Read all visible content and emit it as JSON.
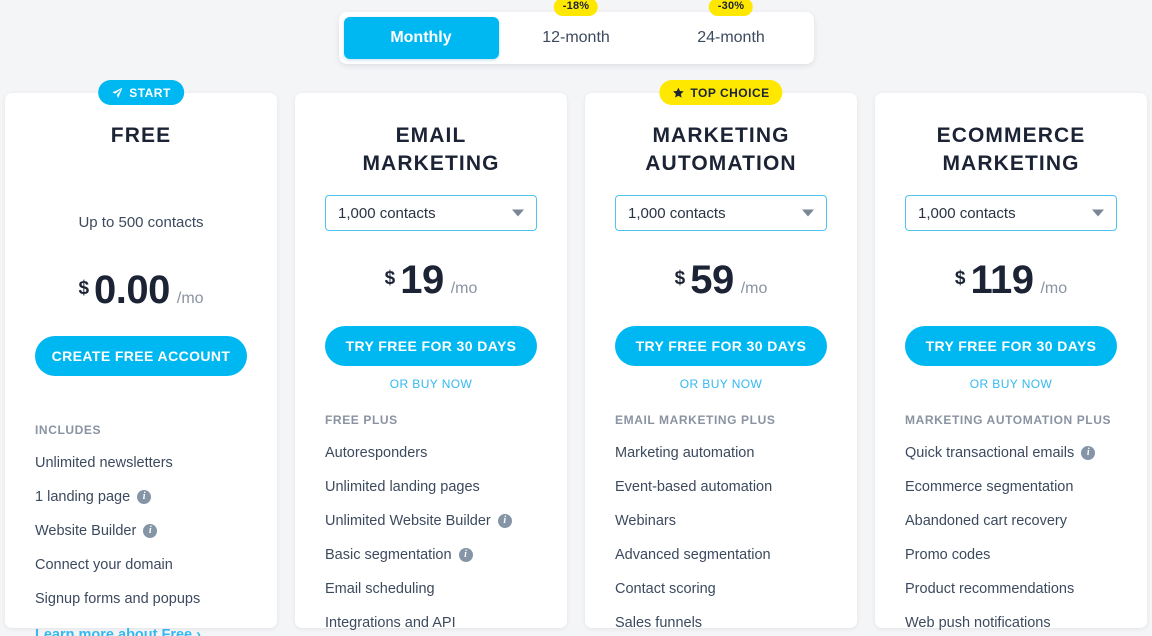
{
  "billing": {
    "options": [
      {
        "label": "Monthly",
        "discount": null,
        "active": true
      },
      {
        "label": "12-month",
        "discount": "-18%",
        "active": false
      },
      {
        "label": "24-month",
        "discount": "-30%",
        "active": false
      }
    ]
  },
  "colors": {
    "accent": "#00b8f1",
    "badge_yellow": "#ffe800",
    "text_dark": "#1b2335",
    "text_muted": "#8a93a2",
    "page_bg": "#f4f5f7"
  },
  "plans": [
    {
      "badge": {
        "text": "START",
        "icon": "rocket-icon",
        "style": "start"
      },
      "title": "FREE",
      "contacts_static": "Up to 500 contacts",
      "contacts_select": null,
      "currency": "$",
      "price": "0.00",
      "period": "/mo",
      "cta": "CREATE FREE ACCOUNT",
      "buy_now": null,
      "features_head": "INCLUDES",
      "features": [
        {
          "label": "Unlimited newsletters",
          "info": false
        },
        {
          "label": "1 landing page",
          "info": true
        },
        {
          "label": "Website Builder",
          "info": true
        },
        {
          "label": "Connect your domain",
          "info": false
        },
        {
          "label": "Signup forms and popups",
          "info": false
        }
      ],
      "learn_more": "Learn more about Free ›"
    },
    {
      "badge": null,
      "title": "EMAIL MARKETING",
      "contacts_static": null,
      "contacts_select": "1,000 contacts",
      "currency": "$",
      "price": "19",
      "period": "/mo",
      "cta": "TRY FREE FOR 30 DAYS",
      "buy_now": "OR BUY NOW",
      "features_head": "FREE PLUS",
      "features": [
        {
          "label": "Autoresponders",
          "info": false
        },
        {
          "label": "Unlimited landing pages",
          "info": false
        },
        {
          "label": "Unlimited Website Builder",
          "info": true
        },
        {
          "label": "Basic segmentation",
          "info": true
        },
        {
          "label": "Email scheduling",
          "info": false
        },
        {
          "label": "Integrations and API",
          "info": false
        }
      ],
      "learn_more": null
    },
    {
      "badge": {
        "text": "TOP CHOICE",
        "icon": "star-icon",
        "style": "top"
      },
      "title": "MARKETING AUTOMATION",
      "contacts_static": null,
      "contacts_select": "1,000 contacts",
      "currency": "$",
      "price": "59",
      "period": "/mo",
      "cta": "TRY FREE FOR 30 DAYS",
      "buy_now": "OR BUY NOW",
      "features_head": "EMAIL MARKETING PLUS",
      "features": [
        {
          "label": "Marketing automation",
          "info": false
        },
        {
          "label": "Event-based automation",
          "info": false
        },
        {
          "label": "Webinars",
          "info": false
        },
        {
          "label": "Advanced segmentation",
          "info": false
        },
        {
          "label": "Contact scoring",
          "info": false
        },
        {
          "label": "Sales funnels",
          "info": false
        }
      ],
      "learn_more": null
    },
    {
      "badge": null,
      "title": "ECOMMERCE MARKETING",
      "contacts_static": null,
      "contacts_select": "1,000 contacts",
      "currency": "$",
      "price": "119",
      "period": "/mo",
      "cta": "TRY FREE FOR 30 DAYS",
      "buy_now": "OR BUY NOW",
      "features_head": "MARKETING AUTOMATION PLUS",
      "features": [
        {
          "label": "Quick transactional emails",
          "info": true
        },
        {
          "label": "Ecommerce segmentation",
          "info": false
        },
        {
          "label": "Abandoned cart recovery",
          "info": false
        },
        {
          "label": "Promo codes",
          "info": false
        },
        {
          "label": "Product recommendations",
          "info": false
        },
        {
          "label": "Web push notifications",
          "info": false
        }
      ],
      "learn_more": null
    }
  ]
}
